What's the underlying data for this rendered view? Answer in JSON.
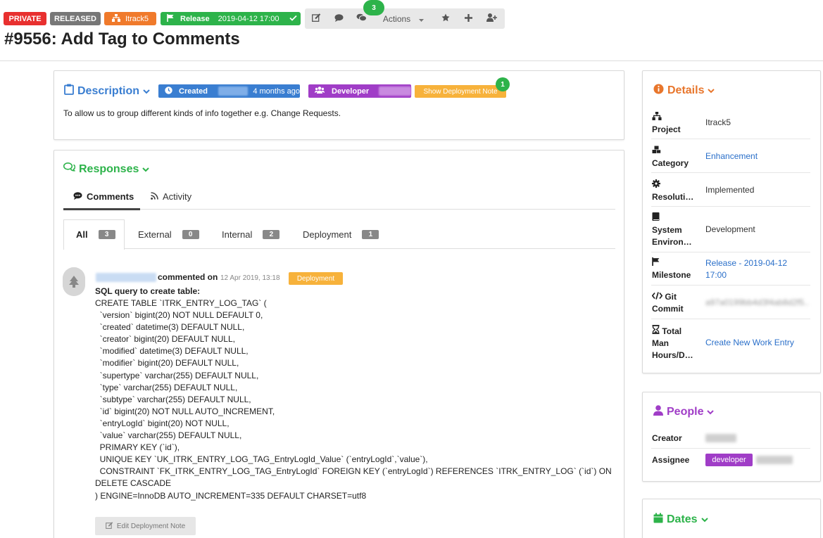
{
  "topbar": {
    "private_label": "PRIVATE",
    "released_label": "RELEASED",
    "project_label": "Itrack5",
    "release_label": "Release",
    "release_date": "2019-04-12 17:00",
    "actions_label": "Actions",
    "comments_count": "3"
  },
  "title": "#9556: Add Tag to Comments",
  "description": {
    "heading": "Description",
    "created_label": "Created",
    "created_when": "4 months ago",
    "developer_label": "Developer",
    "deploy_note_label": "Show Deployment Note",
    "deploy_note_count": "1",
    "text": "To allow us to group different kinds of info together e.g. Change Requests."
  },
  "responses": {
    "heading": "Responses",
    "tabs": [
      {
        "label": "Comments"
      },
      {
        "label": "Activity"
      }
    ],
    "filters": [
      {
        "label": "All",
        "count": "3"
      },
      {
        "label": "External",
        "count": "0"
      },
      {
        "label": "Internal",
        "count": "2"
      },
      {
        "label": "Deployment",
        "count": "1"
      }
    ],
    "comment": {
      "action": "commented on",
      "date": "12 Apr 2019, 13:18",
      "tag": "Deployment",
      "heading": "SQL query to create table:",
      "body": "CREATE TABLE `ITRK_ENTRY_LOG_TAG` (\n  `version` bigint(20) NOT NULL DEFAULT 0,\n  `created` datetime(3) DEFAULT NULL,\n  `creator` bigint(20) DEFAULT NULL,\n  `modified` datetime(3) DEFAULT NULL,\n  `modifier` bigint(20) DEFAULT NULL,\n  `supertype` varchar(255) DEFAULT NULL,\n  `type` varchar(255) DEFAULT NULL,\n  `subtype` varchar(255) DEFAULT NULL,\n  `id` bigint(20) NOT NULL AUTO_INCREMENT,\n  `entryLogId` bigint(20) NOT NULL,\n  `value` varchar(255) DEFAULT NULL,\n  PRIMARY KEY (`id`),\n  UNIQUE KEY `UK_ITRK_ENTRY_LOG_TAG_EntryLogId_Value` (`entryLogId`,`value`),\n  CONSTRAINT `FK_ITRK_ENTRY_LOG_TAG_EntryLogId` FOREIGN KEY (`entryLogId`) REFERENCES `ITRK_ENTRY_LOG` (`id`) ON\nDELETE CASCADE\n) ENGINE=InnoDB AUTO_INCREMENT=335 DEFAULT CHARSET=utf8",
      "edit_label": "Edit Deployment Note"
    }
  },
  "details": {
    "heading": "Details",
    "rows": [
      {
        "label": "Project",
        "value": "Itrack5"
      },
      {
        "label": "Category",
        "value": "Enhancement"
      },
      {
        "label": "Resoluti…",
        "value": "Implemented"
      },
      {
        "label": "System Environ…",
        "value": "Development"
      },
      {
        "label": "Milestone",
        "value": "Release - 2019-04-12 17:00"
      },
      {
        "label": "Git Commit",
        "value": "a97a0199bb4d3f4ab8d2f5..."
      },
      {
        "label": "Total Man Hours/D…",
        "value": "Create New Work Entry"
      }
    ]
  },
  "people": {
    "heading": "People",
    "creator_label": "Creator",
    "assignee_label": "Assignee",
    "assignee_role": "developer"
  },
  "dates": {
    "heading": "Dates"
  },
  "colors": {
    "red": "#e8302f",
    "grey": "#777777",
    "orange": "#f07a2b",
    "green": "#2db34a",
    "blue": "#3a7ed1",
    "purple": "#a03dc7",
    "yellow": "#f7b23b",
    "details_orange": "#e8762c",
    "responses_green": "#2db34a",
    "people_purple": "#a03dc7",
    "dates_green": "#2db34a"
  }
}
